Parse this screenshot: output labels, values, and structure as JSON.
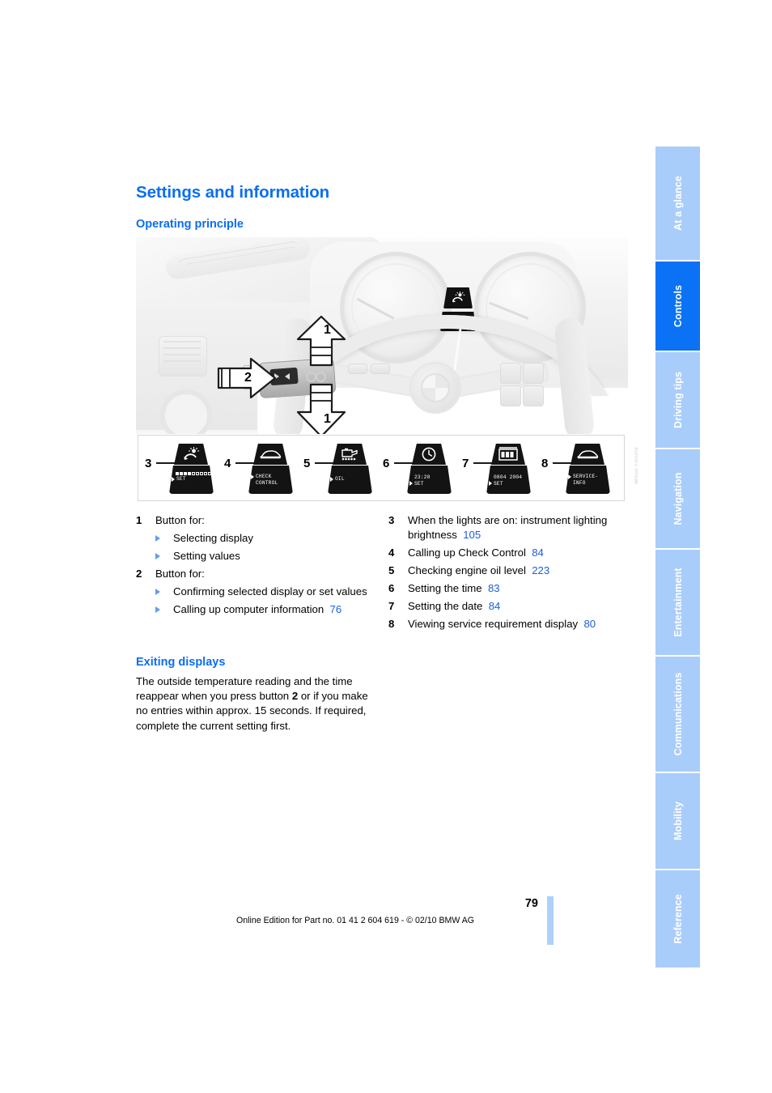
{
  "document": {
    "page_number": "79",
    "footer_note": "Online Edition for Part no. 01 41 2 604 619 - © 02/10 BMW AG"
  },
  "headings": {
    "main_title": "Settings and information",
    "operating_principle": "Operating principle",
    "exiting_displays": "Exiting displays"
  },
  "figure": {
    "code": "IMAGE FIGURE",
    "callouts": [
      {
        "num": "1",
        "position": "up"
      },
      {
        "num": "2",
        "position": "left"
      },
      {
        "num": "1",
        "position": "down"
      }
    ],
    "icons": [
      {
        "num": "3",
        "glyph": "brightness-sun-icon",
        "screen_type": "bargraph",
        "bars_on": 4,
        "bars_off": 6,
        "screen_text": "SET"
      },
      {
        "num": "4",
        "glyph": "car-icon",
        "screen_type": "text",
        "screen_text": "CHECK\nCONTROL"
      },
      {
        "num": "5",
        "glyph": "oil-can-icon",
        "screen_type": "text",
        "screen_text": "OIL"
      },
      {
        "num": "6",
        "glyph": "clock-icon",
        "screen_type": "text",
        "screen_text": "23:20\nSET"
      },
      {
        "num": "7",
        "glyph": "calendar-icon",
        "screen_type": "text",
        "screen_text": "0804 2004\nSET"
      },
      {
        "num": "8",
        "glyph": "car-icon",
        "screen_type": "text",
        "screen_text": "SERVICE-\nINFO"
      }
    ]
  },
  "list_left": [
    {
      "num": "1",
      "text": "Button for:",
      "sub": [
        {
          "text": "Selecting display",
          "page": ""
        },
        {
          "text": "Setting values",
          "page": ""
        }
      ]
    },
    {
      "num": "2",
      "text": "Button for:",
      "sub": [
        {
          "text": "Confirming selected display or set values",
          "page": ""
        },
        {
          "text": "Calling up computer information",
          "page": "76"
        }
      ]
    }
  ],
  "list_right": [
    {
      "num": "3",
      "text": "When the lights are on: instrument lighting brightness",
      "page": "105"
    },
    {
      "num": "4",
      "text": "Calling up Check Control",
      "page": "84"
    },
    {
      "num": "5",
      "text": "Checking engine oil level",
      "page": "223"
    },
    {
      "num": "6",
      "text": "Setting the time",
      "page": "83"
    },
    {
      "num": "7",
      "text": "Setting the date",
      "page": "84"
    },
    {
      "num": "8",
      "text": "Viewing service requirement display",
      "page": "80"
    }
  ],
  "exiting_displays_body": {
    "line1": "The outside temperature reading and the time",
    "line2_pre": "reappear when you press button ",
    "line2_bold": "2",
    "line2_post": " or if you",
    "line3": "make no entries within approx. 15 seconds.",
    "line4": "If required, complete the current setting first."
  },
  "sidebar": {
    "tabs": [
      {
        "label": "At a glance",
        "active": false
      },
      {
        "label": "Controls",
        "active": true
      },
      {
        "label": "Driving tips",
        "active": false
      },
      {
        "label": "Navigation",
        "active": false
      },
      {
        "label": "Entertainment",
        "active": false
      },
      {
        "label": "Communications",
        "active": false
      },
      {
        "label": "Mobility",
        "active": false
      },
      {
        "label": "Reference",
        "active": false
      }
    ]
  },
  "colors": {
    "heading_blue": "#0b6ef0",
    "tab_active": "#0b72f5",
    "tab_inactive": "#a9cdfb",
    "page_link": "#1b5fd9",
    "footer_bar": "#aed0fb"
  }
}
